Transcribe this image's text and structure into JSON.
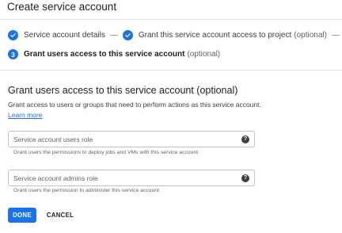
{
  "header": {
    "title": "Create service account"
  },
  "stepper": {
    "steps": [
      {
        "label": "Service account details",
        "state": "completed",
        "icon": "check-icon"
      },
      {
        "label": "Grant this service account access to project",
        "optional": "(optional)",
        "state": "completed",
        "icon": "check-icon"
      },
      {
        "number": "3",
        "label": "Grant users access to this service account",
        "optional": "(optional)",
        "state": "active"
      }
    ]
  },
  "section": {
    "title": "Grant users access to this service account (optional)",
    "description": "Grant access to users or groups that need to perform actions as this service account.",
    "learn_more": "Learn more"
  },
  "fields": [
    {
      "placeholder": "Service account users role",
      "hint": "Grant users the permissions to deploy jobs and VMs with this service account",
      "icon": "help-icon"
    },
    {
      "placeholder": "Service account admins role",
      "hint": "Grant users the permission to administer this service account",
      "icon": "help-icon"
    }
  ],
  "actions": {
    "done": "DONE",
    "cancel": "CANCEL"
  },
  "colors": {
    "accent": "#1a73e8",
    "text": "#202124",
    "muted": "#5f6368",
    "border": "#bdc1c6"
  }
}
